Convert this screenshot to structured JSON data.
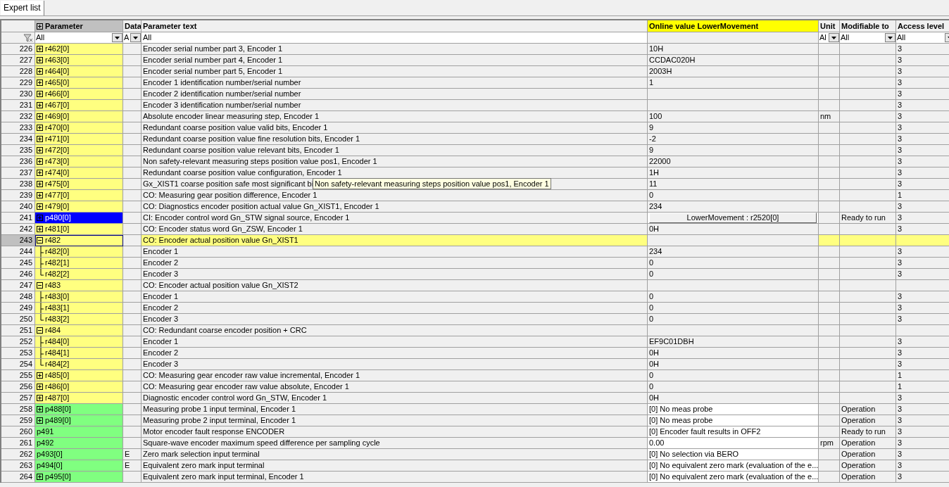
{
  "tabs": [
    {
      "label": "Expert list",
      "selected": true
    }
  ],
  "columns": {
    "parameter": "Parameter",
    "data": "Data",
    "text": "Parameter text",
    "online": "Online value LowerMovement",
    "unit": "Unit",
    "modifiable": "Modifiable to",
    "access": "Access level"
  },
  "filters": {
    "parameter": "All",
    "data": "A",
    "text": "All",
    "unit": "Al",
    "modifiable": "All",
    "access": "All"
  },
  "rows": [
    {
      "num": "226",
      "param": "r462[0]",
      "kind": "indexed",
      "expanded": false,
      "writable": false,
      "selected": false,
      "focused": false,
      "text": "Encoder serial number part 3, Encoder 1",
      "value": "10H",
      "level": "3"
    },
    {
      "num": "227",
      "param": "r463[0]",
      "kind": "indexed",
      "expanded": false,
      "writable": false,
      "selected": false,
      "focused": false,
      "text": "Encoder serial number part 4, Encoder 1",
      "value": "CCDAC020H",
      "level": "3"
    },
    {
      "num": "228",
      "param": "r464[0]",
      "kind": "indexed",
      "expanded": false,
      "writable": false,
      "selected": false,
      "focused": false,
      "text": "Encoder serial number part 5, Encoder 1",
      "value": "2003H",
      "level": "3"
    },
    {
      "num": "229",
      "param": "r465[0]",
      "kind": "indexed",
      "expanded": false,
      "writable": false,
      "selected": false,
      "focused": false,
      "text": "Encoder 1 identification number/serial number",
      "value": "1",
      "level": "3"
    },
    {
      "num": "230",
      "param": "r466[0]",
      "kind": "indexed",
      "expanded": false,
      "writable": false,
      "selected": false,
      "focused": false,
      "text": "Encoder 2 identification number/serial number",
      "level": "3"
    },
    {
      "num": "231",
      "param": "r467[0]",
      "kind": "indexed",
      "expanded": false,
      "writable": false,
      "selected": false,
      "focused": false,
      "text": "Encoder 3 identification number/serial number",
      "level": "3"
    },
    {
      "num": "232",
      "param": "r469[0]",
      "kind": "indexed",
      "expanded": false,
      "writable": false,
      "selected": false,
      "focused": false,
      "text": "Absolute encoder linear measuring step, Encoder 1",
      "value": "100",
      "unit": "nm",
      "level": "3"
    },
    {
      "num": "233",
      "param": "r470[0]",
      "kind": "indexed",
      "expanded": false,
      "writable": false,
      "selected": false,
      "focused": false,
      "text": "Redundant coarse position value valid bits, Encoder 1",
      "value": "9",
      "level": "3"
    },
    {
      "num": "234",
      "param": "r471[0]",
      "kind": "indexed",
      "expanded": false,
      "writable": false,
      "selected": false,
      "focused": false,
      "text": "Redundant coarse position value fine resolution bits, Encoder 1",
      "value": "-2",
      "level": "3"
    },
    {
      "num": "235",
      "param": "r472[0]",
      "kind": "indexed",
      "expanded": false,
      "writable": false,
      "selected": false,
      "focused": false,
      "text": "Redundant coarse position value relevant bits, Encoder 1",
      "value": "9",
      "level": "3"
    },
    {
      "num": "236",
      "param": "r473[0]",
      "kind": "indexed",
      "expanded": false,
      "writable": false,
      "selected": false,
      "focused": false,
      "text": "Non safety-relevant measuring steps position value pos1, Encoder 1",
      "value": "22000",
      "level": "3"
    },
    {
      "num": "237",
      "param": "r474[0]",
      "kind": "indexed",
      "expanded": false,
      "writable": false,
      "selected": false,
      "focused": false,
      "text": "Redundant coarse position value configuration, Encoder 1",
      "value": "1H",
      "level": "3"
    },
    {
      "num": "238",
      "param": "r475[0]",
      "kind": "indexed",
      "expanded": false,
      "writable": false,
      "selected": false,
      "focused": false,
      "text": "Gx_XIST1 coarse position safe most significant bi",
      "tooltip": "Non safety-relevant measuring steps position value pos1, Encoder 1",
      "value": "11",
      "level": "3"
    },
    {
      "num": "239",
      "param": "r477[0]",
      "kind": "indexed",
      "expanded": false,
      "writable": false,
      "selected": false,
      "focused": false,
      "text": "CO: Measuring gear position difference, Encoder 1",
      "value": "0",
      "level": "1"
    },
    {
      "num": "240",
      "param": "r479[0]",
      "kind": "indexed",
      "expanded": false,
      "writable": false,
      "selected": false,
      "focused": false,
      "text": "CO: Diagnostics encoder position actual value Gn_XIST1, Encoder 1",
      "value": "234",
      "level": "3"
    },
    {
      "num": "241",
      "param": "p480[0]",
      "kind": "indexed",
      "expanded": false,
      "writable": true,
      "selected": true,
      "focused": false,
      "text": "CI: Encoder control word Gn_STW signal source, Encoder 1",
      "value": "LowerMovement : r2520[0]",
      "interconnected": true,
      "modifiable": "Ready to run",
      "level": "3"
    },
    {
      "num": "242",
      "param": "r481[0]",
      "kind": "indexed",
      "expanded": false,
      "writable": false,
      "selected": false,
      "focused": false,
      "text": "CO: Encoder status word Gn_ZSW, Encoder 1",
      "value": "0H",
      "level": "3"
    },
    {
      "num": "243",
      "param": "r482",
      "kind": "group",
      "expanded": true,
      "writable": false,
      "selected": false,
      "focused": true,
      "text": "CO: Encoder actual position value Gn_XIST1",
      "children": [
        {
          "num": "244",
          "param": "r482[0]",
          "kind": "element",
          "writable": false,
          "selected": false,
          "focused": false,
          "text": "Encoder 1",
          "value": "234",
          "level": "3"
        },
        {
          "num": "245",
          "param": "r482[1]",
          "kind": "element",
          "writable": false,
          "selected": false,
          "focused": false,
          "text": "Encoder 2",
          "value": "0",
          "level": "3"
        },
        {
          "num": "246",
          "param": "r482[2]",
          "kind": "element",
          "writable": false,
          "selected": false,
          "focused": false,
          "text": "Encoder 3",
          "value": "0",
          "level": "3"
        }
      ]
    },
    {
      "num": "247",
      "param": "r483",
      "kind": "group",
      "expanded": true,
      "writable": false,
      "selected": false,
      "focused": false,
      "text": "CO: Encoder actual position value Gn_XIST2",
      "children": [
        {
          "num": "248",
          "param": "r483[0]",
          "kind": "element",
          "writable": false,
          "selected": false,
          "focused": false,
          "text": "Encoder 1",
          "value": "0",
          "level": "3"
        },
        {
          "num": "249",
          "param": "r483[1]",
          "kind": "element",
          "writable": false,
          "selected": false,
          "focused": false,
          "text": "Encoder 2",
          "value": "0",
          "level": "3"
        },
        {
          "num": "250",
          "param": "r483[2]",
          "kind": "element",
          "writable": false,
          "selected": false,
          "focused": false,
          "text": "Encoder 3",
          "value": "0",
          "level": "3"
        }
      ]
    },
    {
      "num": "251",
      "param": "r484",
      "kind": "group",
      "expanded": true,
      "writable": false,
      "selected": false,
      "focused": false,
      "text": "CO: Redundant coarse encoder position + CRC",
      "children": [
        {
          "num": "252",
          "param": "r484[0]",
          "kind": "element",
          "writable": false,
          "selected": false,
          "focused": false,
          "text": "Encoder 1",
          "value": "EF9C01DBH",
          "level": "3"
        },
        {
          "num": "253",
          "param": "r484[1]",
          "kind": "element",
          "writable": false,
          "selected": false,
          "focused": false,
          "text": "Encoder 2",
          "value": "0H",
          "level": "3"
        },
        {
          "num": "254",
          "param": "r484[2]",
          "kind": "element",
          "writable": false,
          "selected": false,
          "focused": false,
          "text": "Encoder 3",
          "value": "0H",
          "level": "3"
        }
      ]
    },
    {
      "num": "255",
      "param": "r485[0]",
      "kind": "indexed",
      "expanded": false,
      "writable": false,
      "selected": false,
      "focused": false,
      "text": "CO: Measuring gear encoder raw value incremental, Encoder 1",
      "value": "0",
      "level": "1"
    },
    {
      "num": "256",
      "param": "r486[0]",
      "kind": "indexed",
      "expanded": false,
      "writable": false,
      "selected": false,
      "focused": false,
      "text": "CO: Measuring gear encoder raw value absolute, Encoder 1",
      "value": "0",
      "level": "1"
    },
    {
      "num": "257",
      "param": "r487[0]",
      "kind": "indexed",
      "expanded": false,
      "writable": false,
      "selected": false,
      "focused": false,
      "text": "Diagnostic encoder control word Gn_STW, Encoder 1",
      "value": "0H",
      "level": "3"
    },
    {
      "num": "258",
      "param": "p488[0]",
      "kind": "indexed",
      "expanded": false,
      "writable": true,
      "selected": false,
      "focused": false,
      "text": "Measuring probe 1 input terminal, Encoder 1",
      "value": "[0] No meas probe",
      "modifiable": "Operation",
      "level": "3"
    },
    {
      "num": "259",
      "param": "p489[0]",
      "kind": "indexed",
      "expanded": false,
      "writable": true,
      "selected": false,
      "focused": false,
      "text": "Measuring probe 2 input terminal, Encoder 1",
      "value": "[0] No meas probe",
      "modifiable": "Operation",
      "level": "3"
    },
    {
      "num": "260",
      "param": "p491",
      "kind": "scalar",
      "writable": true,
      "selected": false,
      "focused": false,
      "text": "Motor encoder fault response ENCODER",
      "value": "[0] Encoder fault results in OFF2",
      "modifiable": "Ready to run",
      "level": "3"
    },
    {
      "num": "261",
      "param": "p492",
      "kind": "scalar",
      "writable": true,
      "selected": false,
      "focused": false,
      "text": "Square-wave encoder maximum speed difference per sampling cycle",
      "value": "0.00",
      "unit": "rpm",
      "modifiable": "Operation",
      "level": "3"
    },
    {
      "num": "262",
      "param": "p493[0]",
      "kind": "scalar",
      "writable": true,
      "selected": false,
      "focused": false,
      "data": "E",
      "text": "Zero mark selection input terminal",
      "value": "[0] No selection via BERO",
      "modifiable": "Operation",
      "level": "3"
    },
    {
      "num": "263",
      "param": "p494[0]",
      "kind": "scalar",
      "writable": true,
      "selected": false,
      "focused": false,
      "data": "E",
      "text": "Equivalent zero mark input terminal",
      "value": "[0] No equivalent zero mark (evaluation of the e...",
      "modifiable": "Operation",
      "level": "3"
    },
    {
      "num": "264",
      "param": "p495[0]",
      "kind": "indexed",
      "expanded": false,
      "writable": true,
      "selected": false,
      "focused": false,
      "text": "Equivalent zero mark input terminal, Encoder 1",
      "value": "[0] No equivalent zero mark (evaluation of the e...",
      "modifiable": "Operation",
      "level": "3"
    }
  ]
}
